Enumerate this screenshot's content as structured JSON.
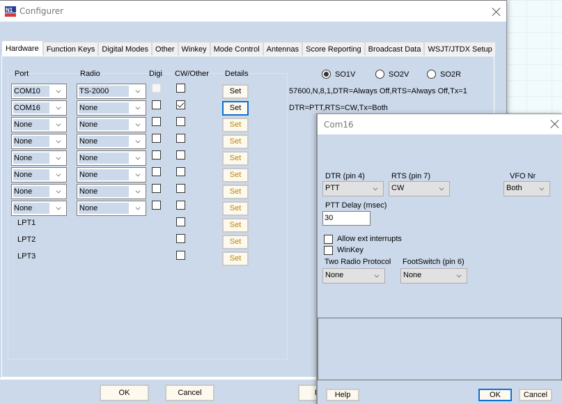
{
  "main_window": {
    "title": "Configurer",
    "app_icon": "n1mm-logo-icon",
    "tabs": [
      "Hardware",
      "Function Keys",
      "Digital Modes",
      "Other",
      "Winkey",
      "Mode Control",
      "Antennas",
      "Score Reporting",
      "Broadcast Data",
      "WSJT/JTDX Setup"
    ],
    "active_tab": "Hardware",
    "hardware": {
      "headers": {
        "port": "Port",
        "radio": "Radio",
        "digi": "Digi",
        "cw_other": "CW/Other",
        "details": "Details"
      },
      "rows": [
        {
          "port": "COM10",
          "radio": "TS-2000",
          "digi": false,
          "digi_enabled": false,
          "cw": false,
          "set": "Set",
          "set_state": "enabled"
        },
        {
          "port": "COM16",
          "radio": "None",
          "digi": false,
          "digi_enabled": true,
          "cw": true,
          "set": "Set",
          "set_state": "focused"
        },
        {
          "port": "None",
          "radio": "None",
          "digi": false,
          "digi_enabled": true,
          "cw": false,
          "set": "Set",
          "set_state": "disabled"
        },
        {
          "port": "None",
          "radio": "None",
          "digi": false,
          "digi_enabled": true,
          "cw": false,
          "set": "Set",
          "set_state": "disabled"
        },
        {
          "port": "None",
          "radio": "None",
          "digi": false,
          "digi_enabled": true,
          "cw": false,
          "set": "Set",
          "set_state": "disabled"
        },
        {
          "port": "None",
          "radio": "None",
          "digi": false,
          "digi_enabled": true,
          "cw": false,
          "set": "Set",
          "set_state": "disabled"
        },
        {
          "port": "None",
          "radio": "None",
          "digi": false,
          "digi_enabled": true,
          "cw": false,
          "set": "Set",
          "set_state": "disabled"
        },
        {
          "port": "None",
          "radio": "None",
          "digi": false,
          "digi_enabled": true,
          "cw": false,
          "set": "Set",
          "set_state": "disabled"
        }
      ],
      "lpt_rows": [
        {
          "label": "LPT1",
          "cw": false,
          "set": "Set"
        },
        {
          "label": "LPT2",
          "cw": false,
          "set": "Set"
        },
        {
          "label": "LPT3",
          "cw": false,
          "set": "Set"
        }
      ],
      "radios": [
        {
          "label": "SO1V",
          "selected": true
        },
        {
          "label": "SO2V",
          "selected": false
        },
        {
          "label": "SO2R",
          "selected": false
        }
      ],
      "info_lines": [
        "57600,N,8,1,DTR=Always Off,RTS=Always Off,Tx=1",
        "DTR=PTT,RTS=CW,Tx=Both"
      ]
    },
    "buttons": {
      "ok": "OK",
      "cancel": "Cancel",
      "help_partial": "H"
    }
  },
  "com_dialog": {
    "title": "Com16",
    "dtr_label": "DTR (pin 4)",
    "dtr_value": "PTT",
    "rts_label": "RTS (pin 7)",
    "rts_value": "CW",
    "vfo_label": "VFO Nr",
    "vfo_value": "Both",
    "ptt_delay_label": "PTT Delay  (msec)",
    "ptt_delay_value": "30",
    "allow_ext_label": "Allow ext interrupts",
    "allow_ext_checked": false,
    "winkey_label": "WinKey",
    "winkey_checked": false,
    "two_radio_label": "Two Radio Protocol",
    "two_radio_value": "None",
    "footswitch_label": "FootSwitch (pin 6)",
    "footswitch_value": "None",
    "buttons": {
      "help": "Help",
      "ok": "OK",
      "cancel": "Cancel"
    }
  }
}
